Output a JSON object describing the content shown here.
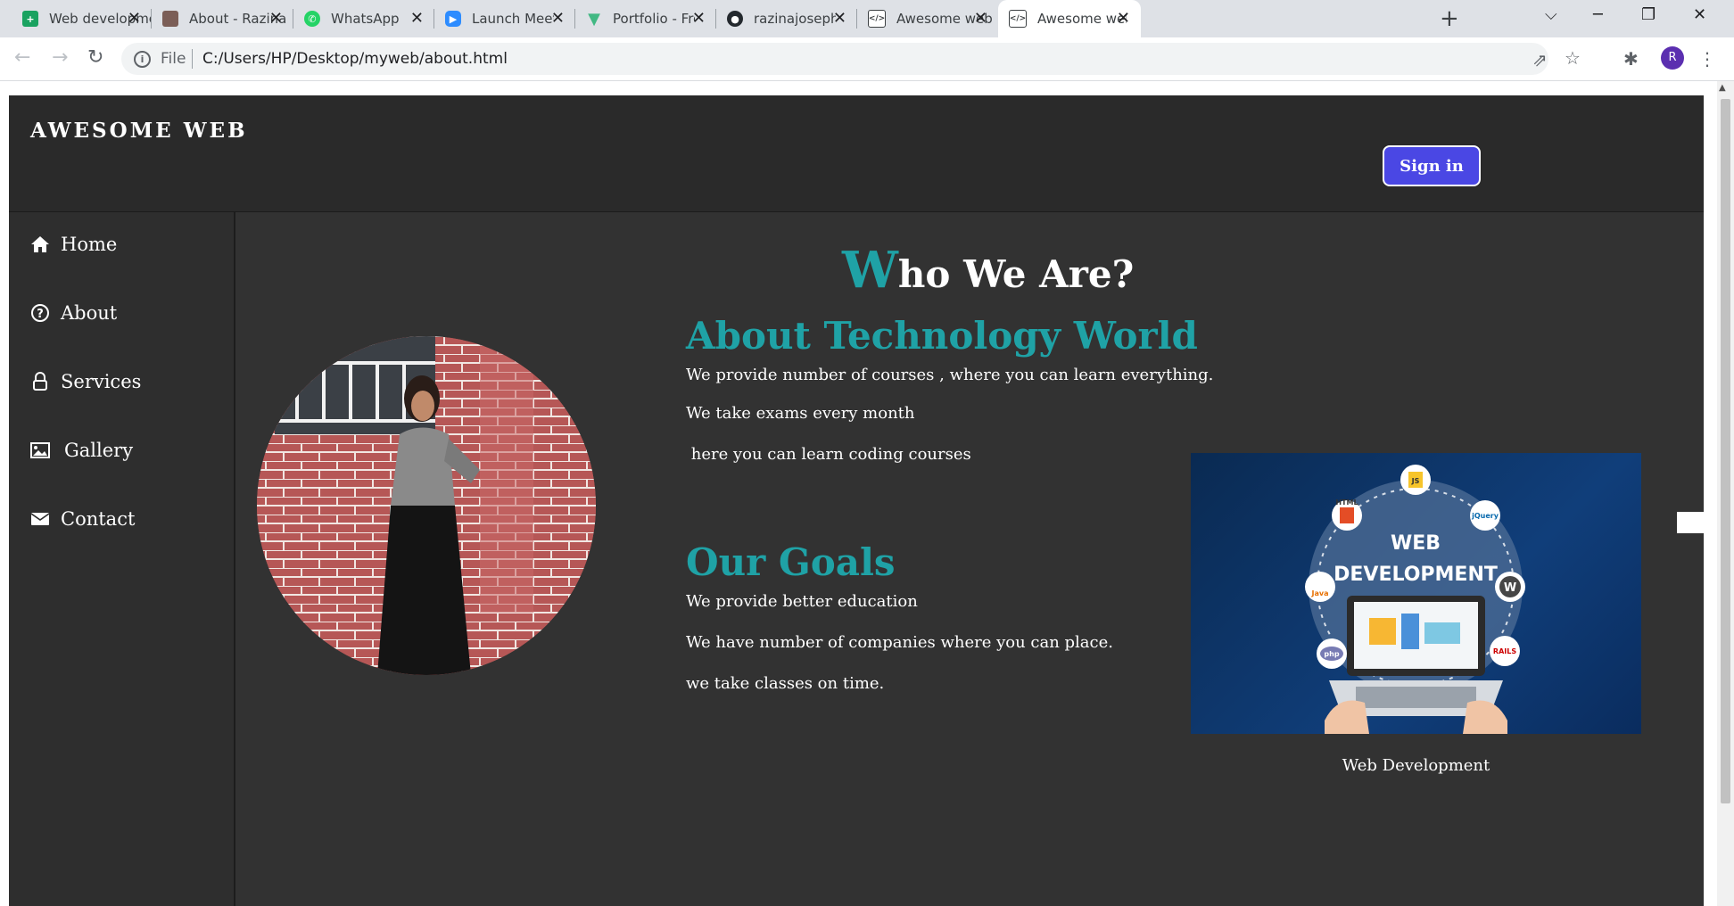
{
  "browser": {
    "tabs": [
      {
        "title": "Web developmen",
        "favicon": "green-doc-icon",
        "color": "#1aa260"
      },
      {
        "title": "About - Razina pc",
        "favicon": "portrait-icon",
        "color": "#7b5e57"
      },
      {
        "title": "WhatsApp",
        "favicon": "whatsapp-icon",
        "color": "#25d366"
      },
      {
        "title": "Launch Meeting",
        "favicon": "zoom-icon",
        "color": "#2d8cff"
      },
      {
        "title": "Portfolio - Free e",
        "favicon": "vue-icon",
        "color": "#41b883"
      },
      {
        "title": "razinajoseph/Port",
        "favicon": "github-icon",
        "color": "#24292e"
      },
      {
        "title": "Awesome web",
        "favicon": "code-file-icon",
        "color": "#3c4043"
      },
      {
        "title": "Awesome web",
        "favicon": "code-file-icon",
        "color": "#3c4043",
        "active": true
      }
    ],
    "url_scheme": "File",
    "url": "C:/Users/HP/Desktop/myweb/about.html",
    "profile_initial": "R"
  },
  "site": {
    "logo": "AWESOME WEB",
    "signin_label": "Sign in",
    "accent_color": "#1fa2a6",
    "nav": [
      {
        "label": "Home",
        "icon": "home-icon"
      },
      {
        "label": "About",
        "icon": "question-circle-icon"
      },
      {
        "label": "Services",
        "icon": "lock-icon"
      },
      {
        "label": "Gallery",
        "icon": "image-icon"
      },
      {
        "label": "Contact",
        "icon": "envelope-icon"
      }
    ],
    "heading_first_letter": "W",
    "heading_rest": "ho We Are?",
    "about": {
      "title": "About Technology World",
      "lines": [
        "We provide number of courses , where you can learn everything.",
        "We take exams every month",
        " here you can learn coding courses"
      ]
    },
    "goals": {
      "title": "Our Goals",
      "lines": [
        "We provide better education",
        "We have number of companies where you can place.",
        "we take classes on time."
      ]
    },
    "image_caption": "Web Development",
    "image_text_line1": "WEB",
    "image_text_line2": "DEVELOPMENT",
    "image_badges": [
      "HTML",
      "JS",
      "jQuery",
      "Java",
      "php",
      "RAILS"
    ]
  }
}
